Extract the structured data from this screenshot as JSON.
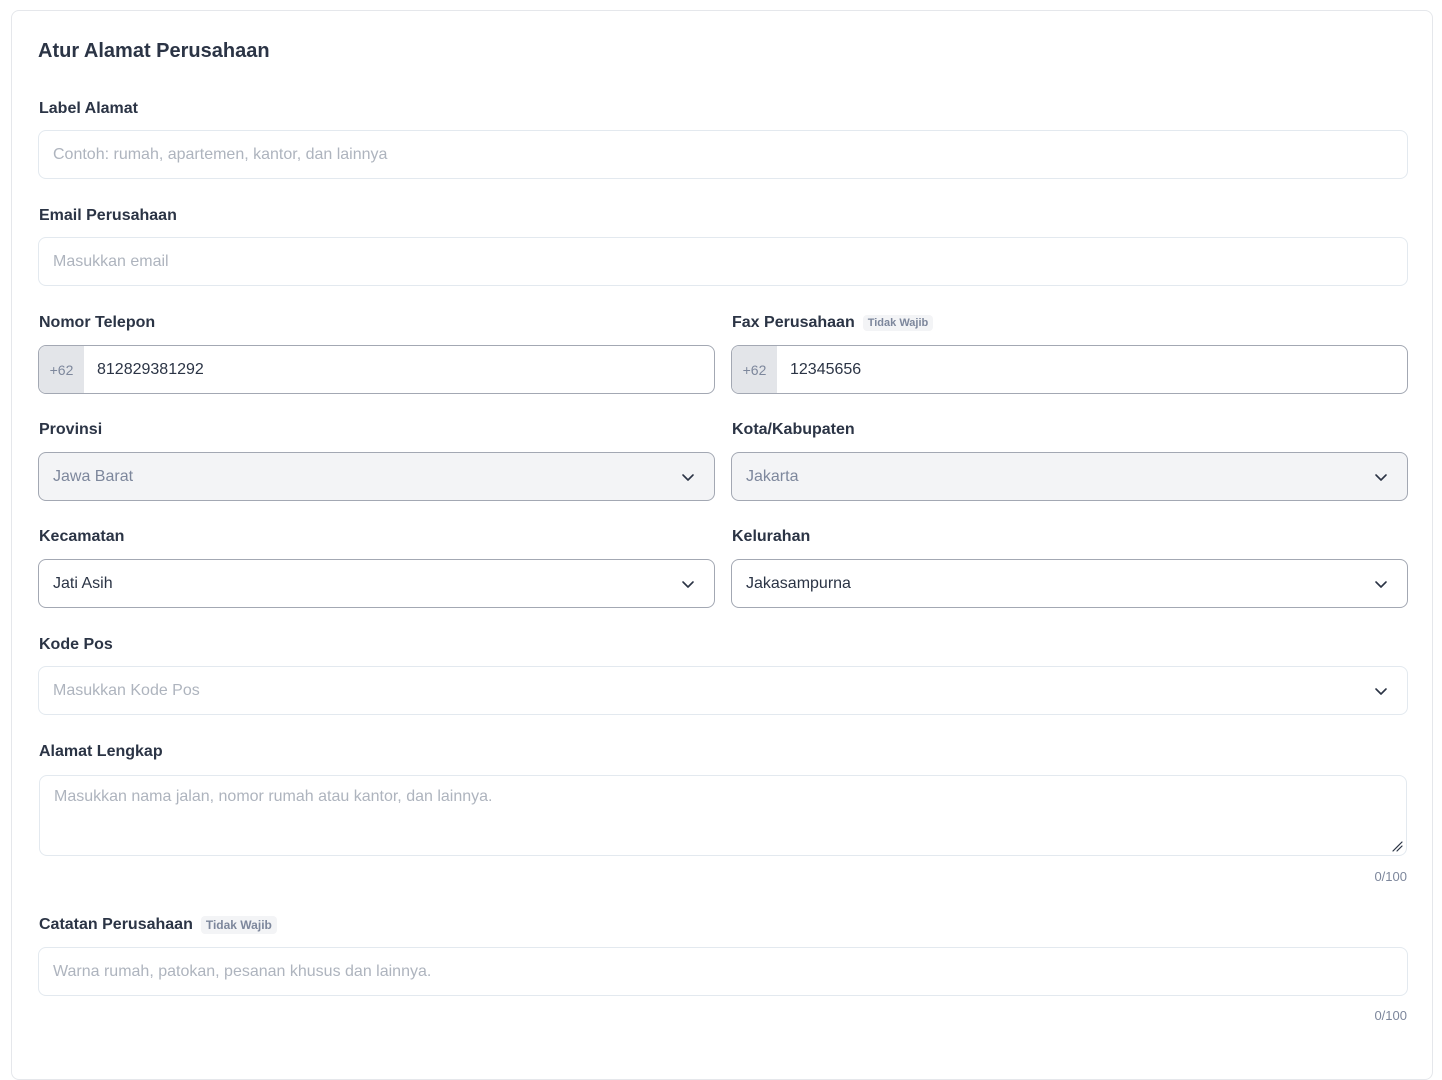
{
  "title": "Atur Alamat Perusahaan",
  "fields": {
    "label_alamat": {
      "label": "Label Alamat",
      "placeholder": "Contoh: rumah, apartemen, kantor, dan lainnya"
    },
    "email": {
      "label": "Email Perusahaan",
      "placeholder": "Masukkan email"
    },
    "phone": {
      "label": "Nomor Telepon",
      "prefix": "+62",
      "value": "812829381292"
    },
    "fax": {
      "label": "Fax Perusahaan",
      "badge": "Tidak Wajib",
      "prefix": "+62",
      "value": "12345656"
    },
    "provinsi": {
      "label": "Provinsi",
      "value": "Jawa Barat"
    },
    "kota": {
      "label": "Kota/Kabupaten",
      "value": "Jakarta"
    },
    "kecamatan": {
      "label": "Kecamatan",
      "value": "Jati Asih"
    },
    "kelurahan": {
      "label": "Kelurahan",
      "value": "Jakasampurna"
    },
    "kode_pos": {
      "label": "Kode Pos",
      "placeholder": "Masukkan Kode Pos"
    },
    "alamat_lengkap": {
      "label": "Alamat Lengkap",
      "placeholder": "Masukkan nama jalan, nomor rumah atau kantor, dan lainnya.",
      "counter": "0/100"
    },
    "catatan": {
      "label": "Catatan Perusahaan",
      "badge": "Tidak Wajib",
      "placeholder": "Warna rumah, patokan, pesanan khusus dan lainnya.",
      "counter": "0/100"
    }
  },
  "icons": {
    "dropdown": "chevron-down-icon",
    "resize": "resize-handle-icon"
  },
  "colors": {
    "text": "#2b3445",
    "muted": "#7d879c",
    "placeholder": "#aeb4be",
    "border": "#e3e9ef",
    "border_dark": "#a3a8b3",
    "disabled_bg": "#f3f4f6",
    "prefix_bg": "#e3e5e9"
  }
}
